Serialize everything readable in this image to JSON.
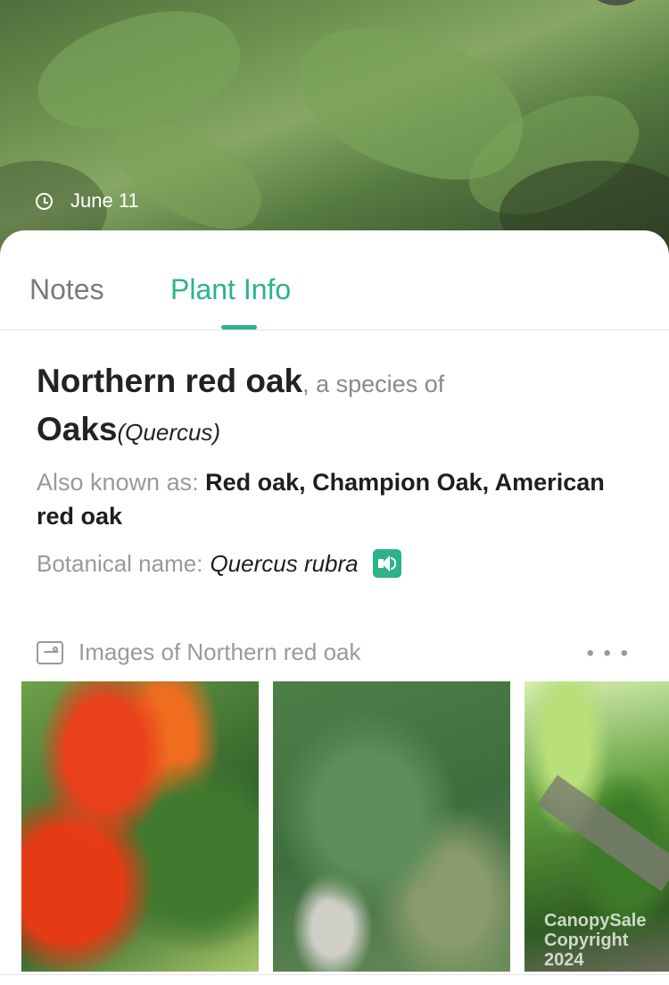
{
  "header": {
    "date": "June 11"
  },
  "tabs": [
    {
      "label": "Notes"
    },
    {
      "label": "Plant Info"
    }
  ],
  "plant": {
    "common_name": "Northern red oak",
    "species_phrase": ", a species of",
    "genus_common": "Oaks",
    "genus_latin": "(Quercus)",
    "aka_label": "Also known as: ",
    "aka_values": "Red oak, Champion Oak, American red oak",
    "botanical_label": "Botanical name:",
    "botanical_name": "Quercus rubra"
  },
  "gallery": {
    "title": "Images of Northern red oak",
    "more_label": "• • •",
    "images": [
      {
        "alt": "red and green oak leaves"
      },
      {
        "alt": "green oak leaves"
      },
      {
        "alt": "oak branch with leaves"
      }
    ],
    "watermark": "CanopySale Copyright 2024"
  },
  "icons": {
    "clock": "clock-icon",
    "speaker": "speaker-icon",
    "image": "image-icon",
    "more": "more-icon"
  },
  "colors": {
    "accent": "#2bb38a",
    "muted_text": "#999999"
  }
}
